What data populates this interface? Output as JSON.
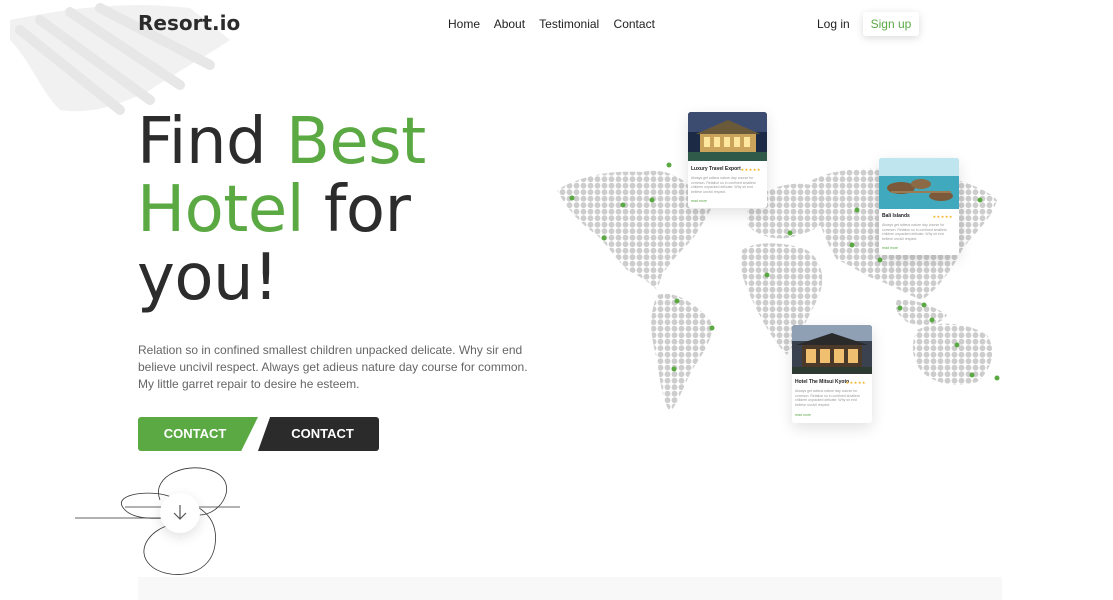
{
  "brand": {
    "name": "Resort.io",
    "accent": "#5aa943",
    "dark": "#2b2b2b"
  },
  "nav": {
    "items": [
      "Home",
      "About",
      "Testimonial",
      "Contact"
    ],
    "login": "Log in",
    "signup": "Sign up"
  },
  "hero": {
    "title_part1": "Find ",
    "title_green1": "Best",
    "title_green2": "Hotel",
    "title_part2": " for",
    "title_part3": "you!",
    "description": "Relation so in confined smallest children unpacked delicate. Why sir end believe uncivil respect. Always get adieus nature day course for common. My little garret repair to desire he esteem.",
    "button_primary": "CONTACT",
    "button_secondary": "CONTACT",
    "scroll_icon": "arrow-down-icon"
  },
  "hotels": [
    {
      "name": "Luxury Travel Export",
      "rating": 5,
      "stars": "★★★★★",
      "text": "Always get adieus nature day course for common. Relation so in confined smallest children unpacked delicate. Why sir end believe uncivil respect.",
      "link": "read more"
    },
    {
      "name": "Bali Islands",
      "rating": 5,
      "stars": "★★★★★",
      "text": "Always get adieus nature day course for common. Relation so in confined smallest children unpacked delicate. Why sir end believe uncivil respect.",
      "link": "read more"
    },
    {
      "name": "Hotel The Mitsui Kyoto",
      "rating": 5,
      "stars": "★★★★★",
      "text": "Always get adieus nature day course for common. Relation so in confined smallest children unpacked delicate. Why sir end believe uncivil respect.",
      "link": "read more"
    }
  ]
}
